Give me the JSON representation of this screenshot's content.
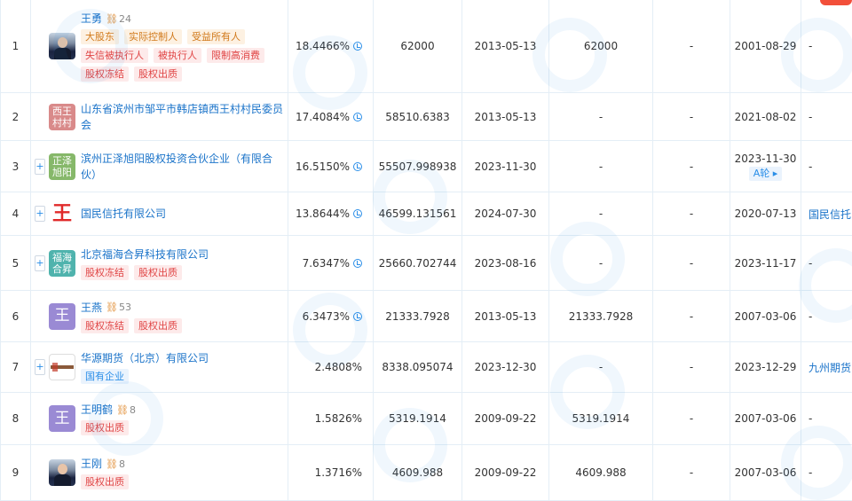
{
  "rows": [
    {
      "idx": "1",
      "logo": {
        "type": "photo"
      },
      "name": "王勇",
      "count": "24",
      "expand": false,
      "tags": [
        {
          "t": "大股东",
          "c": "gold"
        },
        {
          "t": "实际控制人",
          "c": "gold"
        },
        {
          "t": "受益所有人",
          "c": "gold"
        },
        {
          "t": "失信被执行人",
          "c": "red"
        },
        {
          "t": "被执行人",
          "c": "red"
        },
        {
          "t": "限制高消费",
          "c": "red"
        },
        {
          "t": "股权冻结",
          "c": "red"
        },
        {
          "t": "股权出质",
          "c": "red"
        }
      ],
      "pct": "18.4466%",
      "amount": "62000",
      "date1": "2013-05-13",
      "paid": "62000",
      "col7": "-",
      "date2": "2001-08-29",
      "round": "",
      "related": "-"
    },
    {
      "idx": "2",
      "logo": {
        "type": "text",
        "text": "西王村村",
        "color": "#d98a8a"
      },
      "name": "山东省滨州市邹平市韩店镇西王村村民委员会",
      "count": "",
      "expand": false,
      "tags": [],
      "pct": "17.4084%",
      "amount": "58510.6383",
      "date1": "2013-05-13",
      "paid": "-",
      "col7": "-",
      "date2": "2021-08-02",
      "round": "",
      "related": "-"
    },
    {
      "idx": "3",
      "logo": {
        "type": "text",
        "text": "正泽旭阳",
        "color": "#86b86a"
      },
      "name": "滨州正泽旭阳股权投资合伙企业（有限合伙）",
      "count": "",
      "expand": true,
      "tags": [],
      "pct": "16.5150%",
      "amount": "55507.998938",
      "date1": "2023-11-30",
      "paid": "-",
      "col7": "-",
      "date2": "2023-11-30",
      "round": "A轮 ▸",
      "related": "-"
    },
    {
      "idx": "4",
      "logo": {
        "type": "text",
        "text": "王",
        "color": "#e02a2a"
      },
      "name": "国民信托有限公司",
      "count": "",
      "expand": true,
      "tags": [],
      "pct": "13.8644%",
      "amount": "46599.131561",
      "date1": "2024-07-30",
      "paid": "-",
      "col7": "-",
      "date2": "2020-07-13",
      "round": "",
      "related": "国民信托"
    },
    {
      "idx": "5",
      "logo": {
        "type": "text",
        "text": "福海合昇",
        "color": "#4fb3ad"
      },
      "name": "北京福海合昇科技有限公司",
      "count": "",
      "expand": true,
      "tags": [
        {
          "t": "股权冻结",
          "c": "red"
        },
        {
          "t": "股权出质",
          "c": "red"
        }
      ],
      "pct": "7.6347%",
      "amount": "25660.702744",
      "date1": "2023-08-16",
      "paid": "-",
      "col7": "-",
      "date2": "2023-11-17",
      "round": "",
      "related": "-"
    },
    {
      "idx": "6",
      "logo": {
        "type": "text",
        "text": "王",
        "color": "#9a8ad4"
      },
      "name": "王燕",
      "count": "53",
      "expand": false,
      "tags": [
        {
          "t": "股权冻结",
          "c": "red"
        },
        {
          "t": "股权出质",
          "c": "red"
        }
      ],
      "pct": "6.3473%",
      "amount": "21333.7928",
      "date1": "2013-05-13",
      "paid": "21333.7928",
      "col7": "-",
      "date2": "2007-03-06",
      "round": "",
      "related": "-"
    },
    {
      "idx": "7",
      "logo": {
        "type": "xt"
      },
      "name": "华源期货（北京）有限公司",
      "count": "",
      "expand": true,
      "tags": [
        {
          "t": "国有企业",
          "c": "blue"
        }
      ],
      "pct": "2.4808%",
      "amount": "8338.095074",
      "date1": "2023-12-30",
      "paid": "-",
      "col7": "-",
      "date2": "2023-12-29",
      "round": "",
      "related": "九州期货"
    },
    {
      "idx": "8",
      "logo": {
        "type": "text",
        "text": "王",
        "color": "#9a8ad4"
      },
      "name": "王明鹤",
      "count": "8",
      "expand": false,
      "tags": [
        {
          "t": "股权出质",
          "c": "red"
        }
      ],
      "pct": "1.5826%",
      "amount": "5319.1914",
      "date1": "2009-09-22",
      "paid": "5319.1914",
      "col7": "-",
      "date2": "2007-03-06",
      "round": "",
      "related": "-"
    },
    {
      "idx": "9",
      "logo": {
        "type": "photo"
      },
      "name": "王刚",
      "count": "8",
      "expand": false,
      "tags": [
        {
          "t": "股权出质",
          "c": "red"
        }
      ],
      "pct": "1.3716%",
      "amount": "4609.988",
      "date1": "2009-09-22",
      "paid": "4609.988",
      "col7": "-",
      "date2": "2007-03-06",
      "round": "",
      "related": "-"
    }
  ]
}
